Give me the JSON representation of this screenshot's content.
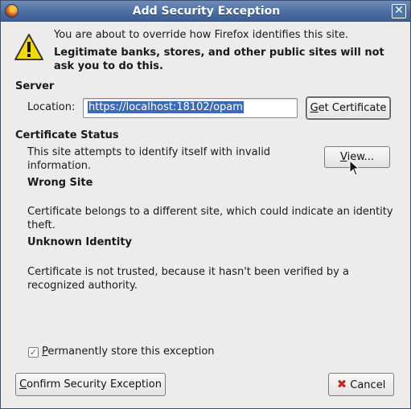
{
  "window": {
    "title": "Add Security Exception",
    "close_glyph": "✕"
  },
  "intro": {
    "line1": "You are about to override how Firefox identifies this site.",
    "line2": "Legitimate banks, stores, and other public sites will not ask you to do this."
  },
  "server": {
    "heading": "Server",
    "location_label": "Location:",
    "location_value": "https://localhost:18102/opam",
    "get_certificate_label": "Get Certificate"
  },
  "certificate_status": {
    "heading": "Certificate Status",
    "summary": "This site attempts to identify itself with invalid information.",
    "view_label": "View...",
    "issues": [
      {
        "title": "Wrong Site",
        "description": "Certificate belongs to a different site, which could indicate an identity theft."
      },
      {
        "title": "Unknown Identity",
        "description": "Certificate is not trusted, because it hasn't been verified by a recognized authority."
      }
    ]
  },
  "options": {
    "permanent_label": "Permanently store this exception",
    "permanent_checked": true,
    "check_glyph": "✓"
  },
  "actions": {
    "confirm_label": "Confirm Security Exception",
    "cancel_label": "Cancel",
    "cancel_glyph": "✖"
  },
  "icons": {
    "app": "firefox-icon",
    "warning": "warning-icon",
    "cursor": "mouse-pointer-icon"
  },
  "colors": {
    "titlebar": "#4a6ca1",
    "selection": "#3d6bb3",
    "warning_fill": "#f5d90f",
    "cancel_icon": "#c6291d"
  }
}
